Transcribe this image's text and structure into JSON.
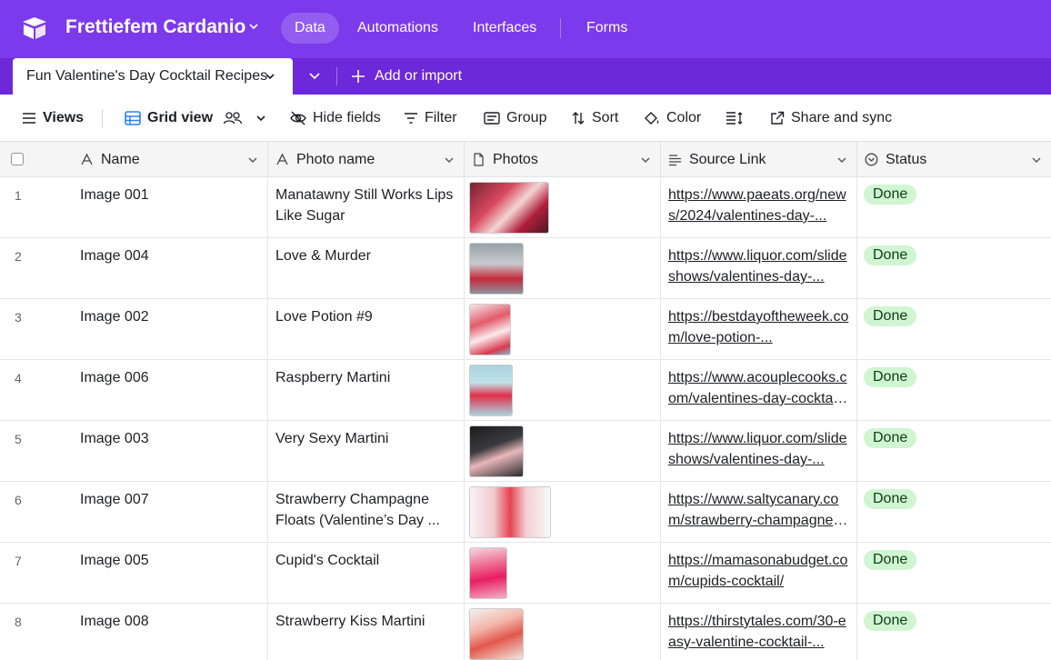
{
  "app": {
    "base_name": "Frettiefem Cardanio",
    "nav": [
      "Data",
      "Automations",
      "Interfaces",
      "Forms"
    ],
    "nav_active": "Data"
  },
  "tabbar": {
    "active_table": "Fun Valentine's Day Cocktail Recipes",
    "add_import": "Add or import"
  },
  "toolbar": {
    "views": "Views",
    "grid_view": "Grid view",
    "hide_fields": "Hide fields",
    "filter": "Filter",
    "group": "Group",
    "sort": "Sort",
    "color": "Color",
    "share_sync": "Share and sync"
  },
  "columns": [
    {
      "label": "Name",
      "icon": "text-a-icon"
    },
    {
      "label": "Photo name",
      "icon": "text-a-icon"
    },
    {
      "label": "Photos",
      "icon": "document-icon"
    },
    {
      "label": "Source Link",
      "icon": "long-text-icon"
    },
    {
      "label": "Status",
      "icon": "check-circle-icon"
    }
  ],
  "rows": [
    {
      "num": "1",
      "name": "Image 001",
      "photo_name": "Manatawny Still Works Lips Like Sugar",
      "link": "https://www.paeats.org/news/2024/valentines-day-...",
      "status": "Done"
    },
    {
      "num": "2",
      "name": "Image 004",
      "photo_name": "Love & Murder",
      "link": "https://www.liquor.com/slideshows/valentines-day-...",
      "status": "Done"
    },
    {
      "num": "3",
      "name": "Image 002",
      "photo_name": "Love Potion #9",
      "link": "https://bestdayoftheweek.com/love-potion-...",
      "status": "Done"
    },
    {
      "num": "4",
      "name": "Image 006",
      "photo_name": "Raspberry Martini",
      "link": "https://www.acouplecooks.com/valentines-day-cocktail...",
      "status": "Done"
    },
    {
      "num": "5",
      "name": "Image 003",
      "photo_name": "Very Sexy Martini",
      "link": "https://www.liquor.com/slideshows/valentines-day-...",
      "status": "Done"
    },
    {
      "num": "6",
      "name": "Image 007",
      "photo_name": "Strawberry Champagne Floats (Valentine’s Day ...",
      "link": "https://www.saltycanary.com/strawberry-champagne-...",
      "status": "Done"
    },
    {
      "num": "7",
      "name": "Image 005",
      "photo_name": "Cupid's Cocktail",
      "link": "https://mamasonabudget.com/cupids-cocktail/",
      "status": "Done"
    },
    {
      "num": "8",
      "name": "Image 008",
      "photo_name": "Strawberry Kiss Martini",
      "link": "https://thirstytales.com/30-easy-valentine-cocktail-...",
      "status": "Done"
    }
  ],
  "colors": {
    "topbar": "#7c3aed",
    "tabbar": "#6d28d9",
    "status_done_bg": "#cff5d1"
  }
}
